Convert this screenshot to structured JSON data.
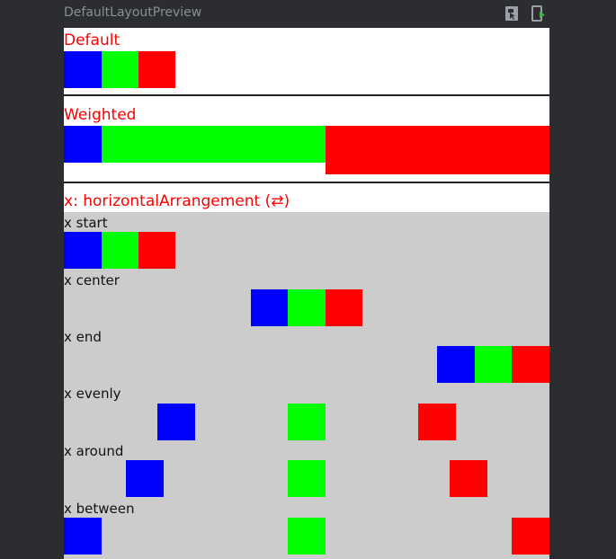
{
  "window": {
    "title": "DefaultLayoutPreview"
  },
  "toolbar": {
    "icons": [
      "interactive-mode-icon",
      "deploy-preview-icon"
    ]
  },
  "colors": {
    "blue": "#0000ff",
    "green": "#00ff00",
    "red": "#ff0000",
    "title": "#ff0000",
    "grey_bg": "#cccccc"
  },
  "sections": {
    "default": {
      "title": "Default"
    },
    "weighted": {
      "title": "Weighted"
    },
    "horizontal": {
      "title": "x: horizontalArrangement (⇄)",
      "rows": [
        {
          "label": "x start"
        },
        {
          "label": "x center"
        },
        {
          "label": "x end"
        },
        {
          "label": "x evenly"
        },
        {
          "label": "x around"
        },
        {
          "label": "x between"
        }
      ]
    }
  }
}
